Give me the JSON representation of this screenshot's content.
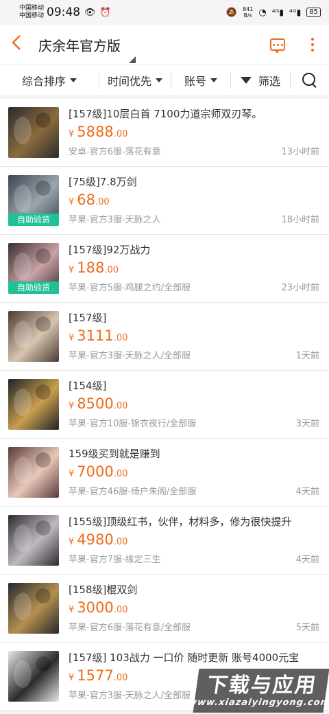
{
  "status_bar": {
    "carrier_1": "中国移动",
    "carrier_2": "中国移动",
    "time": "09:48",
    "net_speed_value": "841",
    "net_speed_unit": "B/s",
    "signal_1": "⁴ᴳ",
    "signal_2": "⁴ᴳ",
    "battery": "85"
  },
  "header": {
    "back_icon": "chevron-left-icon",
    "title": "庆余年官方版",
    "message_icon": "message-icon",
    "more_icon": "more-vertical-icon"
  },
  "filters": {
    "sort": "综合排序",
    "time": "时间优先",
    "account": "账号",
    "filter": "筛选",
    "search_icon": "search-icon"
  },
  "colors": {
    "accent": "#ef6b1b",
    "badge": "#21c196",
    "meta_text": "#999999"
  },
  "listings": [
    {
      "title": "[157级]10层白首 7100力道宗师双刃琴。",
      "price_int": "5888",
      "price_dec": ".00",
      "server": "安卓-官方6服-落花有意",
      "time": "13小时前",
      "badge": ""
    },
    {
      "title": "[75级]7.8万剑",
      "price_int": "68",
      "price_dec": ".00",
      "server": "苹果-官方3服-天脉之人",
      "time": "18小时前",
      "badge": "自助验货"
    },
    {
      "title": "[157级]92万战力",
      "price_int": "188",
      "price_dec": ".00",
      "server": "苹果-官方5服-鸡腿之约/全部服",
      "time": "23小时前",
      "badge": "自助验货"
    },
    {
      "title": "[157级]",
      "price_int": "3111",
      "price_dec": ".00",
      "server": "苹果-官方3服-天脉之人/全部服",
      "time": "1天前",
      "badge": ""
    },
    {
      "title": "[154级]",
      "price_int": "8500",
      "price_dec": ".00",
      "server": "苹果-官方10服-锦衣夜行/全部服",
      "time": "3天前",
      "badge": ""
    },
    {
      "title": "159级买到就是赚到",
      "price_int": "7000",
      "price_dec": ".00",
      "server": "苹果-官方46服-绮户朱阁/全部服",
      "time": "4天前",
      "badge": ""
    },
    {
      "title": "[155级]顶级红书，伙伴，材料多，修为很快提升",
      "price_int": "4980",
      "price_dec": ".00",
      "server": "苹果-官方7服-缘定三生",
      "time": "4天前",
      "badge": ""
    },
    {
      "title": "[158级]棍双剑",
      "price_int": "3000",
      "price_dec": ".00",
      "server": "苹果-官方6服-落花有意/全部服",
      "time": "5天前",
      "badge": ""
    },
    {
      "title": "[157级] 103战力 一口价 随时更新 账号4000元宝",
      "price_int": "1577",
      "price_dec": ".00",
      "server": "苹果-官方3服-天脉之人/全部服",
      "time": "",
      "badge": ""
    }
  ],
  "currency": "¥",
  "watermark": {
    "main": "下载与应用",
    "sub": "www.xiazaiyingyong.com"
  }
}
